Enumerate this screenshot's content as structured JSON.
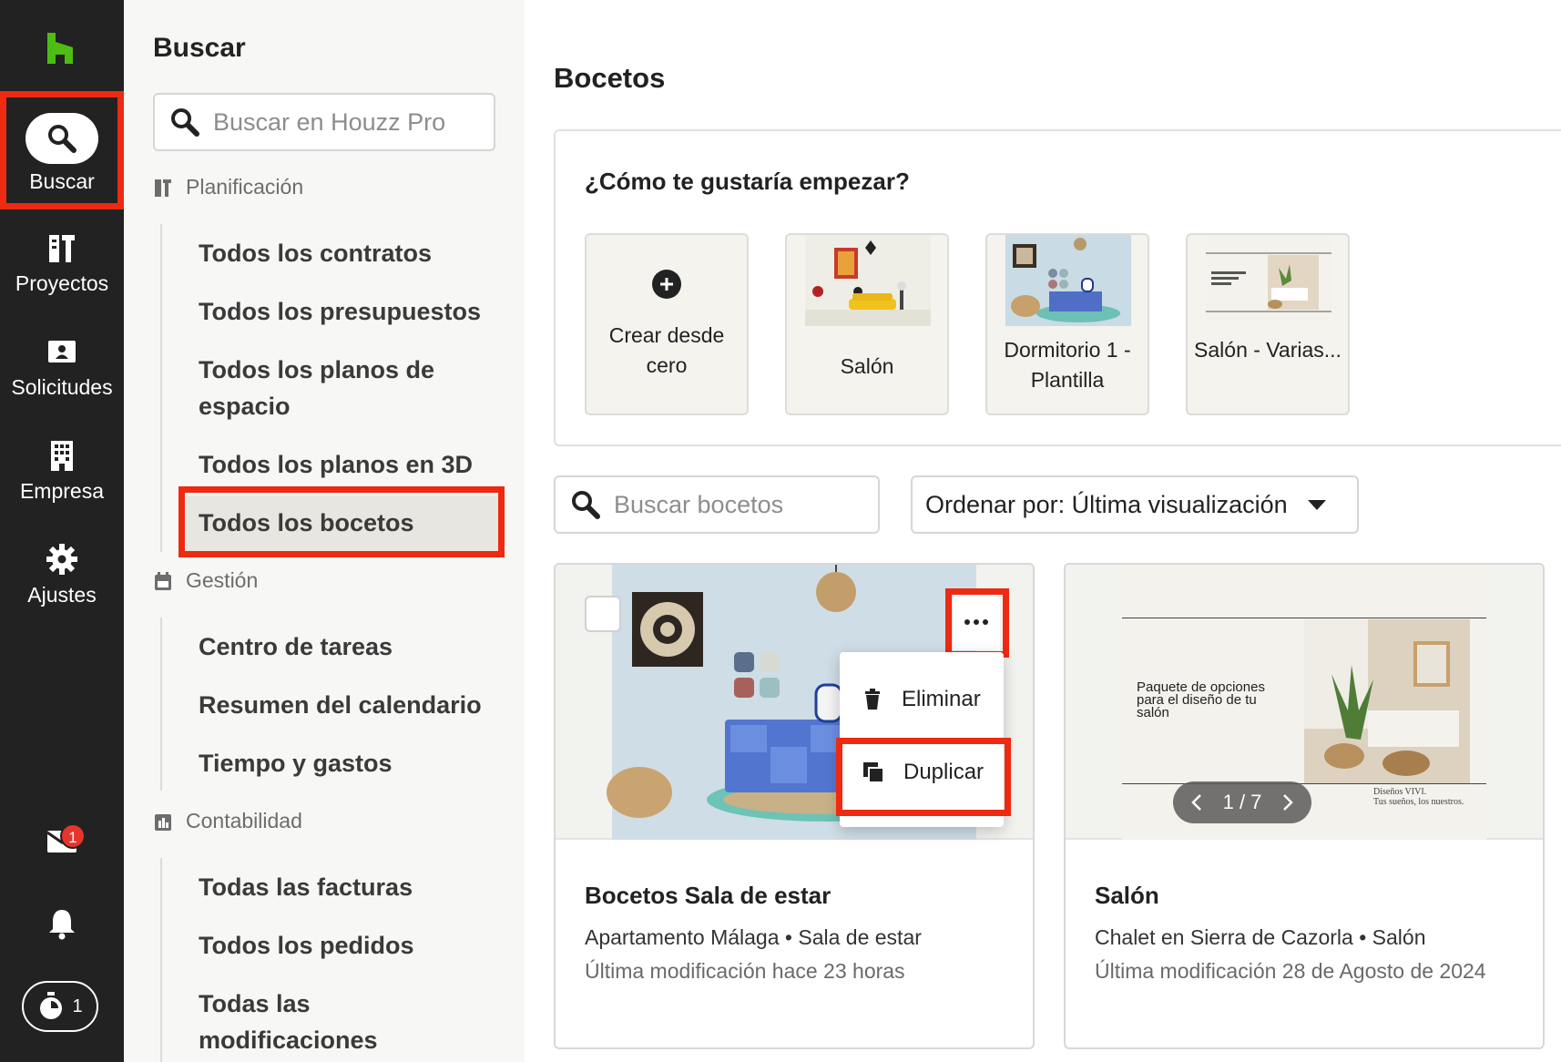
{
  "rail": {
    "items": [
      {
        "label": "Buscar",
        "icon": "search-icon"
      },
      {
        "label": "Proyectos",
        "icon": "projects-icon"
      },
      {
        "label": "Solicitudes",
        "icon": "leads-icon"
      },
      {
        "label": "Empresa",
        "icon": "building-icon"
      },
      {
        "label": "Ajustes",
        "icon": "gear-icon"
      }
    ],
    "inbox_badge": "1",
    "timer_count": "1"
  },
  "subnav": {
    "title": "Buscar",
    "search_placeholder": "Buscar en Houzz Pro",
    "sections": [
      {
        "heading": "Planificación",
        "links": [
          "Todos los contratos",
          "Todos los presupuestos",
          "Todos los planos de espacio",
          "Todos los planos en 3D",
          "Todos los bocetos"
        ]
      },
      {
        "heading": "Gestión",
        "links": [
          "Centro de tareas",
          "Resumen del calendario",
          "Tiempo y gastos"
        ]
      },
      {
        "heading": "Contabilidad",
        "links": [
          "Todas las facturas",
          "Todos los pedidos",
          "Todas las modificaciones"
        ]
      }
    ]
  },
  "main": {
    "title": "Bocetos",
    "start": {
      "question": "¿Cómo te gustaría empezar?",
      "templates": [
        "Crear desde cero",
        "Salón",
        "Dormitorio 1 - Plantilla",
        "Salón - Varias..."
      ]
    },
    "search_placeholder": "Buscar bocetos",
    "sort_label": "Ordenar por: Última visualización",
    "cards": [
      {
        "title": "Bocetos Sala de estar",
        "project": "Apartamento Málaga",
        "room": "Sala de estar",
        "modified": "Última modificación hace 23 horas"
      },
      {
        "title": "Salón",
        "project": "Chalet en Sierra de Cazorla",
        "room": "Salón",
        "modified": "Última modificación 28 de Agosto de 2024",
        "pager": "1 / 7",
        "slide_text": "Paquete de opciones para el diseño de tu salón",
        "slide_footer_1": "Diseños VIVI.",
        "slide_footer_2": "Tus sueños, los nuestros."
      }
    ],
    "menu": [
      "Eliminar",
      "Duplicar"
    ]
  },
  "colors": {
    "rail_bg": "#222222",
    "brand_green": "#4dbc15",
    "highlight": "#ee2a12"
  }
}
